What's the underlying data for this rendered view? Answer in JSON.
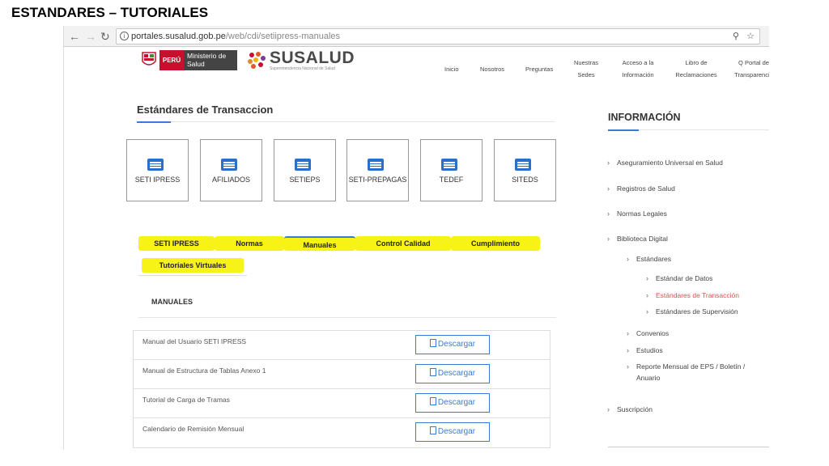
{
  "slide_title": "ESTANDARES – TUTORIALES",
  "browser": {
    "url_host": "portales.susalud.gob.pe",
    "url_path": "/web/cdi/setiipress-manuales",
    "zoom_icon": "magnifier-icon",
    "star_icon": "star-icon"
  },
  "header": {
    "peru_label": "PERÚ",
    "ministerio_label": "Ministerio de Salud",
    "brand": "SUSALUD",
    "brand_sub": "Superintendencia Nacional de Salud",
    "nav": [
      {
        "label": "Inicio"
      },
      {
        "label": "Nosotros"
      },
      {
        "label": "Preguntas"
      },
      {
        "label": "Nuestras Sedes"
      },
      {
        "label": "Acceso a la Información"
      },
      {
        "label": "Libro de Reclamaciones"
      },
      {
        "label": "Q Portal de Transparencia"
      }
    ]
  },
  "main": {
    "title": "Estándares de Transaccion",
    "cards": [
      {
        "label": "SETI IPRESS"
      },
      {
        "label": "AFILIADOS"
      },
      {
        "label": "SETIEPS"
      },
      {
        "label": "SETI-PREPAGAS"
      },
      {
        "label": "TEDEF"
      },
      {
        "label": "SITEDS"
      }
    ],
    "tabs": [
      {
        "label": "SETI IPRESS"
      },
      {
        "label": "Normas"
      },
      {
        "label": "Manuales"
      },
      {
        "label": "Control Calidad"
      },
      {
        "label": "Cumplimiento"
      },
      {
        "label": "Tutoriales Virtuales"
      }
    ],
    "section_title": "MANUALES",
    "download_label": "Descargar",
    "rows": [
      {
        "name": "Manual del Usuario SETI IPRESS"
      },
      {
        "name": "Manual de Estructura de Tablas Anexo 1"
      },
      {
        "name": "Tutorial de Carga de Tramas"
      },
      {
        "name": "Calendario de Remisión Mensual"
      }
    ]
  },
  "sidebar": {
    "title": "INFORMACIÓN",
    "items": [
      {
        "label": "Aseguramiento Universal en Salud"
      },
      {
        "label": "Registros de Salud"
      },
      {
        "label": "Normas Legales"
      },
      {
        "label": "Biblioteca Digital"
      },
      {
        "label": "Estándares"
      },
      {
        "label": "Estándar de Datos"
      },
      {
        "label": "Estándares de Transacción"
      },
      {
        "label": "Estándares de Supervisión"
      },
      {
        "label": "Convenios"
      },
      {
        "label": "Estudios"
      },
      {
        "label": "Reporte Mensual de EPS / Boletín / Anuario"
      },
      {
        "label": "Suscripción"
      }
    ]
  },
  "colors": {
    "highlight": "#f8f316",
    "accent": "#3a7bd5",
    "active_link": "#d9534f"
  }
}
